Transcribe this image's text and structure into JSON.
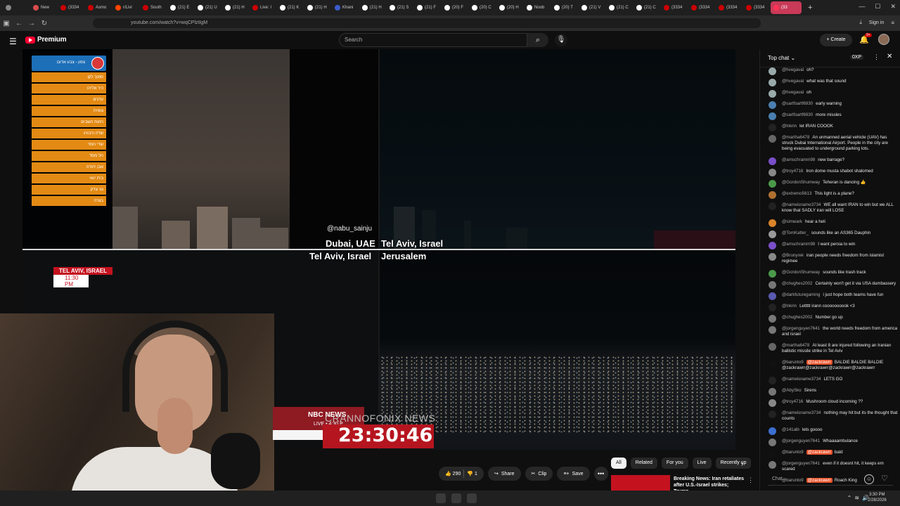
{
  "browser": {
    "tabs": [
      {
        "label": "",
        "color": "#888"
      },
      {
        "label": "New",
        "color": "#d94c4c"
      },
      {
        "label": "(3334",
        "color": "#cc0000"
      },
      {
        "label": "Asmo",
        "color": "#cc0000"
      },
      {
        "label": "r/Livi",
        "color": "#ff4500"
      },
      {
        "label": "South",
        "color": "#cc0000"
      },
      {
        "label": "(21) E",
        "color": "#fff"
      },
      {
        "label": "(21) U",
        "color": "#fff"
      },
      {
        "label": "(21) H",
        "color": "#fff"
      },
      {
        "label": "Live: I",
        "color": "#cc0000"
      },
      {
        "label": "(21) K",
        "color": "#fff"
      },
      {
        "label": "(21) H",
        "color": "#fff"
      },
      {
        "label": "Khani",
        "color": "#3a5ccc"
      },
      {
        "label": "(21) H",
        "color": "#fff"
      },
      {
        "label": "(21) S",
        "color": "#fff"
      },
      {
        "label": "(21) F",
        "color": "#fff"
      },
      {
        "label": "(20) F",
        "color": "#fff"
      },
      {
        "label": "(20) C",
        "color": "#fff"
      },
      {
        "label": "(20) H",
        "color": "#fff"
      },
      {
        "label": "Noob",
        "color": "#fff"
      },
      {
        "label": "(20) T",
        "color": "#fff"
      },
      {
        "label": "(21) V",
        "color": "#fff"
      },
      {
        "label": "(21) C",
        "color": "#fff"
      },
      {
        "label": "(21) C",
        "color": "#fff"
      },
      {
        "label": "(3334",
        "color": "#cc0000"
      },
      {
        "label": "(3334",
        "color": "#cc0000"
      },
      {
        "label": "(3334",
        "color": "#cc0000"
      },
      {
        "label": "(3334",
        "color": "#cc0000"
      }
    ],
    "active_tab": "(33",
    "url": "youtube.com/watch?v=wqCPlztIgM",
    "signin": "Sign in"
  },
  "header": {
    "brand": "Premium",
    "search_placeholder": "Search",
    "create_label": "Create",
    "notif_count": "9+"
  },
  "video": {
    "alert_title": "צפון - צבע אדום",
    "alert_rows": [
      "סמוך לקו",
      "כיר אליהו",
      "עדנים",
      "צופית",
      "רמות השבים",
      "שדה ורבורג",
      "שדי חמד",
      "חל מסד",
      "אבן יהודה",
      "בית ינאי",
      "גני צדק",
      "בצרה"
    ],
    "handle": "@nabu_sainju",
    "labels": {
      "dubai": "Dubai, UAE",
      "tel_aviv_top": "Tel Aviv, Israel",
      "tel_aviv_bottom": "Tel Aviv, Israel",
      "jerusalem": "Jerusalem"
    },
    "loc_badge": {
      "line1": "TEL AVIV, ISRAEL",
      "line2": "11:30 PM"
    },
    "nbc": {
      "brand": "NBC NEWS",
      "live": "LIVE • 4:30 P"
    },
    "watermark": "CRANNOFONIX NEWS",
    "clock": "23:30:46"
  },
  "actions": {
    "likes": "290",
    "dislikes": "1",
    "share": "Share",
    "clip": "Clip",
    "save": "Save",
    "more": "•••"
  },
  "filters": [
    "All",
    "Related",
    "For you",
    "Live",
    "Recently up"
  ],
  "recommendation": {
    "title": "Breaking News: Iran retaliates after U.S.-Israel strikes; Trump..."
  },
  "chat": {
    "title": "Top chat",
    "xp": "0XP",
    "input_placeholder": "Chat...",
    "messages": [
      {
        "author": "@hvegaval",
        "text": "oh?",
        "color": "#9aa"
      },
      {
        "author": "@hvegaval",
        "text": "what was that sound",
        "color": "#9aa"
      },
      {
        "author": "@hvegaval",
        "text": "oh",
        "color": "#9aa"
      },
      {
        "author": "@sartfsartf6930",
        "text": "early warning",
        "color": "#4a7fb0"
      },
      {
        "author": "@sartfsartf6930",
        "text": "more missles",
        "color": "#4a7fb0"
      },
      {
        "author": "@lnkrin",
        "text": "let IRAN COOOK",
        "color": "#222"
      },
      {
        "author": "@martha6478",
        "text": "An unmanned aerial vehicle (UAV) has struck Dubai International Airport. People in the city are being evacuated to underground parking lots.",
        "color": "#666"
      },
      {
        "author": "@amschramm98",
        "text": "new barrage?",
        "color": "#7a4fc9"
      },
      {
        "author": "@troy4716",
        "text": "Iron dome musta shabot shalomed",
        "color": "#888"
      },
      {
        "author": "@GordonShumway",
        "text": "Teheran is dancing 👍",
        "color": "#4a9a4a"
      },
      {
        "author": "@extremo5613",
        "text": "This light is a plane?",
        "color": "#b07030"
      },
      {
        "author": "@nameisname3734",
        "text": "WE all want IRAN to win but we ALL know that SADLY iran will LOSE",
        "color": "#222"
      },
      {
        "author": "@simwark",
        "text": "hear a heli",
        "color": "#d9832b"
      },
      {
        "author": "@TomKatter_",
        "text": "sounds like an AS365 Dauphin",
        "color": "#999"
      },
      {
        "author": "@amschramm98",
        "text": "I want persia to win",
        "color": "#7a4fc9"
      },
      {
        "author": "@Brunyrek",
        "text": "iran people needs freedom from islamist regimee",
        "color": "#888"
      },
      {
        "author": "@GordonShumway",
        "text": "sounds like trash track",
        "color": "#4a9a4a"
      },
      {
        "author": "@chughes2002",
        "text": "Certainly won't get it via USA dumbassery",
        "color": "#777"
      },
      {
        "author": "@darkfuturegaming",
        "text": "i just hope both teams have fun",
        "color": "#5a5ab0"
      },
      {
        "author": "@lnkrin",
        "text": "Lettttt irann coooooooook <3",
        "color": "#222"
      },
      {
        "author": "@chughes2002",
        "text": "Number go up",
        "color": "#777"
      },
      {
        "author": "@jorgenguyen7641",
        "text": "the world needs freedom from america and israel",
        "color": "#777"
      },
      {
        "author": "@martha6478",
        "text": "At least 8 are injured following an Iranian ballistic missile strike in Tel Aviv",
        "color": "#666"
      },
      {
        "author": "@baruntо9",
        "mention": "@zackrawrr",
        "text": "BALDIE BALDIE BALDIE @zackrawrr@zackrawrr@zackrawrr@zackrawrr",
        "color": "#111"
      },
      {
        "author": "@nameisname3734",
        "text": "LETS GO",
        "color": "#222"
      },
      {
        "author": "@AbySko",
        "text": "Sirens",
        "color": "#777"
      },
      {
        "author": "@troy4716",
        "text": "Mushroom cloud incoming ??",
        "color": "#888"
      },
      {
        "author": "@nameisname3734",
        "text": "nothing may hit but its the thought that counts",
        "color": "#222"
      },
      {
        "author": "@141alb",
        "text": "lets goooo",
        "color": "#3a6fd0"
      },
      {
        "author": "@jorgenguyen7641",
        "text": "Whaaaambulance",
        "color": "#777"
      },
      {
        "author": "@baruntо9",
        "mention": "@zackrawrr",
        "text": "bald",
        "color": "#111"
      },
      {
        "author": "@jorgenguyen7641",
        "text": "even if it doesnt hit, it keeps em scared",
        "color": "#777"
      },
      {
        "author": "@baruntо9",
        "mention": "@zackrawrr",
        "text": "Roach King",
        "color": "#111"
      }
    ]
  },
  "taskbar": {
    "time": "3:30 PM",
    "date": "2/28/2026"
  }
}
